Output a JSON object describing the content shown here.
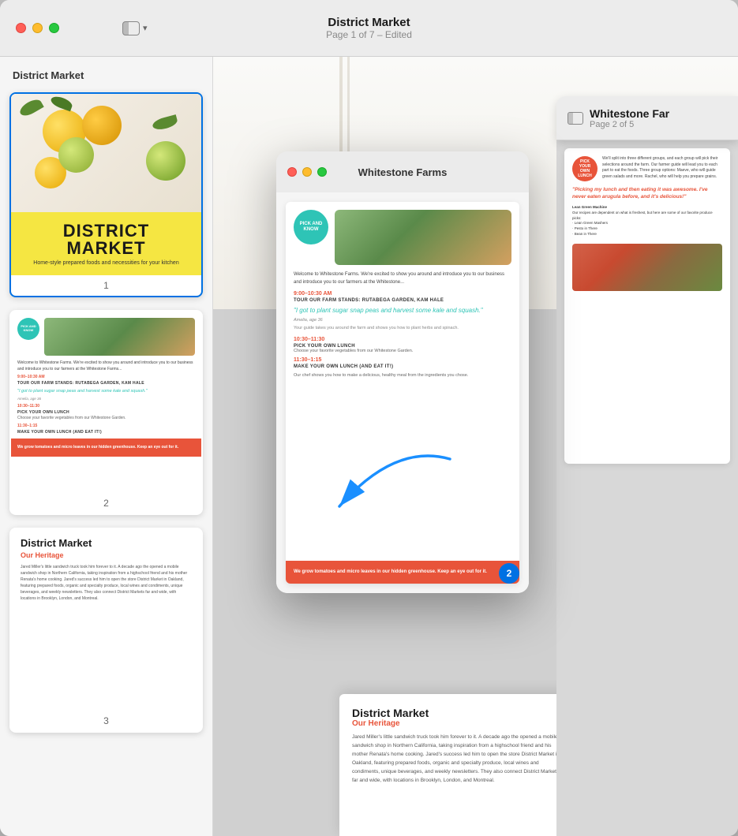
{
  "main_window": {
    "title": "District Market",
    "subtitle": "Page 1 of 7 – Edited",
    "sidebar_toggle_label": "sidebar toggle"
  },
  "sidebar": {
    "title": "District Market",
    "pages": [
      {
        "number": "1",
        "label": "1"
      },
      {
        "number": "2",
        "label": "2"
      },
      {
        "number": "3",
        "label": "3"
      }
    ]
  },
  "cover_page": {
    "title": "DISTRICT",
    "subtitle": "MARKET",
    "tagline": "Home-style prepared foods and necessities for your kitchen"
  },
  "page2": {
    "circle_text": "PICK AND\nKNOW",
    "welcome_heading": "Welcome to Whitestone Farms.",
    "welcome_body": "We're excited to show you around and introduce you to our business and introduce you to our farmers at the Whitestone Farms...",
    "time1": "9:00–10:30 AM",
    "time1_label": "TOUR OUR FARM STANDS: RUTABEGA GARDEN, KAM HALE",
    "quote": "\"I got to plant sugar snap peas and harvest some kale and squash.\"",
    "quote_attr": "Amelia, age 36",
    "time2": "10:30–11:30",
    "time2_label": "PICK YOUR OWN LUNCH",
    "time2_body": "Choose your favorite vegetables from our Whitestone Garden.",
    "time3": "11:30–1:15",
    "time3_label": "MAKE YOUR OWN LUNCH (AND EAT IT!)",
    "footer_text": "We grow tomatoes and micro leaves in our hidden greenhouse. Keep an eye out for it.",
    "page_badge": "2"
  },
  "second_window": {
    "title": "Whitestone Far",
    "subtitle": "Page 2 of 5",
    "pick_circle": "PICK YOUR\nOWN\nLUNCH",
    "quote2": "\"Picking my lunch and then eating it was awesome. I've never eaten arugula before, and it's delicious!\"",
    "lean_green_title": "Lean Green Machine"
  },
  "whitestone_window": {
    "title": "Whitestone Farms",
    "traffic_lights": {
      "close": "close",
      "minimize": "minimize",
      "maximize": "maximize"
    },
    "circle_text": "PICK AND\nKNOW",
    "welcome_text": "Welcome to Whitestone Farms. We're excited to show you around and introduce you to our business and introduce you to our farmers at the Whitestone...",
    "time1": "9:00–10:30 AM",
    "label1": "TOUR OUR FARM STANDS: RUTABEGA GARDEN, KAM HALE",
    "quote": "\"I got to plant sugar snap peas and harvest some kale and squash.\"",
    "time2": "10:30–11:30",
    "label2": "PICK YOUR OWN LUNCH",
    "label2_body": "Choose your favorite vegetables from our Whitestone Garden.",
    "time3": "11:30–1:15",
    "label3": "MAKE YOUR OWN LUNCH (AND EAT IT!)",
    "footer": "We grow tomatoes and micro leaves in our hidden greenhouse. Keep an eye out for it."
  },
  "page3_thumb": {
    "title": "District Market",
    "subtitle": "Our Heritage",
    "body": "Jared Miller's little sandwich truck took him forever to it. A decade ago the opened a mobile sandwich shop in Northern California, taking inspiration from a highschool friend and his mother Renata's home cooking. Jared's success led him to open the store District Market in Oakland, featuring prepared foods, organic and specialty produce, local wines and condiments, unique beverages, and weekly newsletters. They also connect District Markets far and wide, with locations in Brooklyn, London, and Montreal."
  },
  "colors": {
    "teal": "#2ec4b6",
    "orange": "#e8543a",
    "yellow": "#f5e642",
    "blue": "#0071e3"
  }
}
